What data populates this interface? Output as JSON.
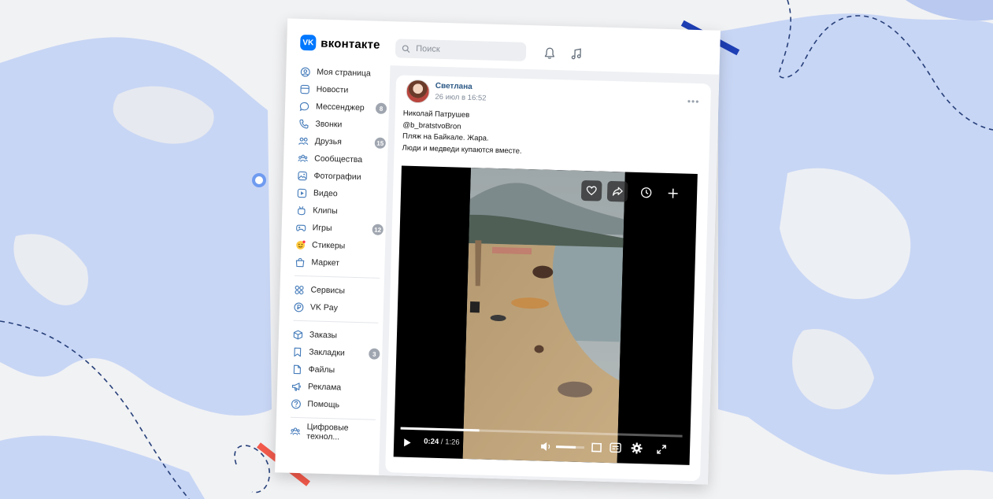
{
  "brand": {
    "name": "вконтакте",
    "logo_glyph": "VK",
    "accent": "#0077ff"
  },
  "search": {
    "placeholder": "Поиск"
  },
  "header_icons": [
    "bell-icon",
    "music-icon"
  ],
  "sidebar": {
    "items": [
      {
        "label": "Моя страница",
        "icon": "user-circle-icon",
        "badge": ""
      },
      {
        "label": "Новости",
        "icon": "news-icon",
        "badge": ""
      },
      {
        "label": "Мессенджер",
        "icon": "chat-bubble-icon",
        "badge": "8"
      },
      {
        "label": "Звонки",
        "icon": "phone-icon",
        "badge": ""
      },
      {
        "label": "Друзья",
        "icon": "friends-icon",
        "badge": "15"
      },
      {
        "label": "Сообщества",
        "icon": "communities-icon",
        "badge": ""
      },
      {
        "label": "Фотографии",
        "icon": "photo-icon",
        "badge": ""
      },
      {
        "label": "Видео",
        "icon": "video-icon",
        "badge": ""
      },
      {
        "label": "Клипы",
        "icon": "clips-icon",
        "badge": ""
      },
      {
        "label": "Игры",
        "icon": "gamepad-icon",
        "badge": "12"
      },
      {
        "label": "Стикеры",
        "icon": "sticker-icon",
        "badge": ""
      },
      {
        "label": "Маркет",
        "icon": "shopping-bag-icon",
        "badge": ""
      }
    ],
    "items2": [
      {
        "label": "Сервисы",
        "icon": "services-icon",
        "badge": ""
      },
      {
        "label": "VK Pay",
        "icon": "vkpay-icon",
        "badge": ""
      }
    ],
    "items3": [
      {
        "label": "Заказы",
        "icon": "box-icon",
        "badge": ""
      },
      {
        "label": "Закладки",
        "icon": "bookmark-icon",
        "badge": "3"
      },
      {
        "label": "Файлы",
        "icon": "file-icon",
        "badge": ""
      },
      {
        "label": "Реклама",
        "icon": "megaphone-icon",
        "badge": ""
      },
      {
        "label": "Помощь",
        "icon": "help-icon",
        "badge": ""
      }
    ],
    "items4": [
      {
        "label": "Цифровые технол...",
        "icon": "communities-icon",
        "badge": ""
      }
    ]
  },
  "post": {
    "author": "Светлана",
    "date": "26 июл в 16:52",
    "lines": [
      "Николай Патрушев",
      "@b_bratstvoBron",
      "Пляж на Байкале. Жара.",
      "Люди и медведи купаются вместе."
    ]
  },
  "video": {
    "current_time": "0:24",
    "duration": "1:26",
    "progress": 0.28,
    "volume": 0.7
  }
}
